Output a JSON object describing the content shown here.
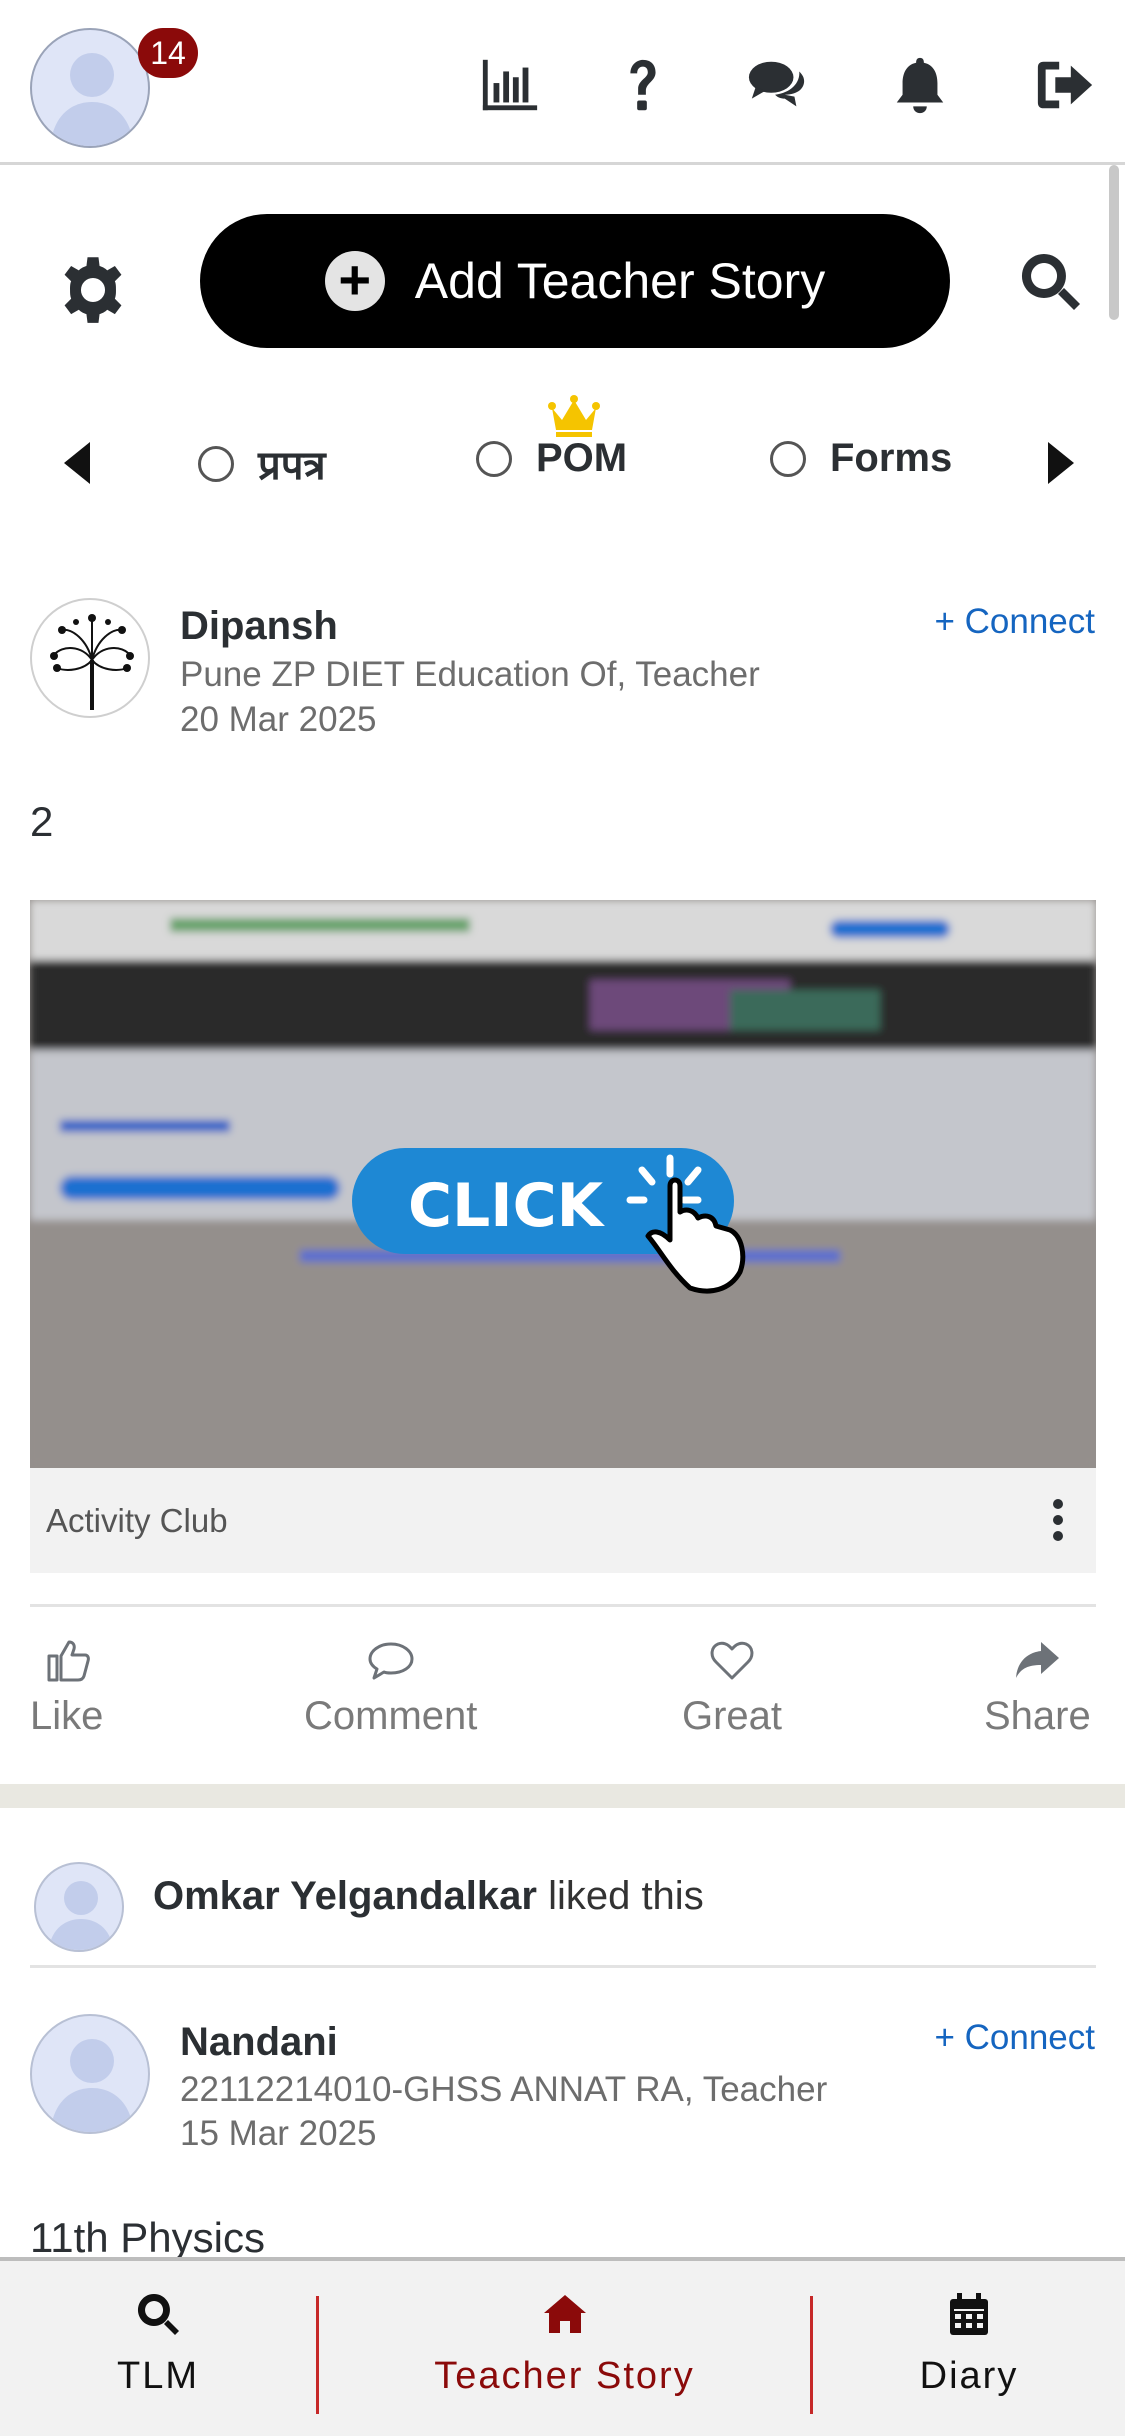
{
  "header": {
    "notification_count": "14",
    "icons": [
      "bar-chart-icon",
      "help-icon",
      "chat-icon",
      "bell-icon",
      "logout-icon"
    ]
  },
  "toolbar": {
    "add_story_label": "Add Teacher Story"
  },
  "filters": {
    "items": [
      {
        "label": "प्रपत्र",
        "selected": false
      },
      {
        "label": "POM",
        "selected": false,
        "crown": true
      },
      {
        "label": "Forms",
        "selected": false
      }
    ]
  },
  "posts": [
    {
      "author": "Dipansh",
      "subtitle": "Pune ZP DIET Education Of, Teacher",
      "date": "20 Mar 2025",
      "connect_label": "+ Connect",
      "text": "2",
      "image_text": "CLICK",
      "caption": "Activity Club"
    },
    {
      "author": "Nandani",
      "subtitle": "22112214010-GHSS ANNAT RA, Teacher",
      "date": "15 Mar 2025",
      "connect_label": "+ Connect",
      "text": "11th Physics"
    }
  ],
  "actions": {
    "like": "Like",
    "comment": "Comment",
    "great": "Great",
    "share": "Share"
  },
  "liked": {
    "name": "Omkar Yelgandalkar",
    "suffix": "liked this"
  },
  "bottom_nav": {
    "items": [
      {
        "label": "TLM",
        "active": false
      },
      {
        "label": "Teacher Story",
        "active": true
      },
      {
        "label": "Diary",
        "active": false
      }
    ]
  },
  "colors": {
    "accent": "#8b0a0a",
    "link": "#1565c0",
    "button_bg": "#000000"
  }
}
